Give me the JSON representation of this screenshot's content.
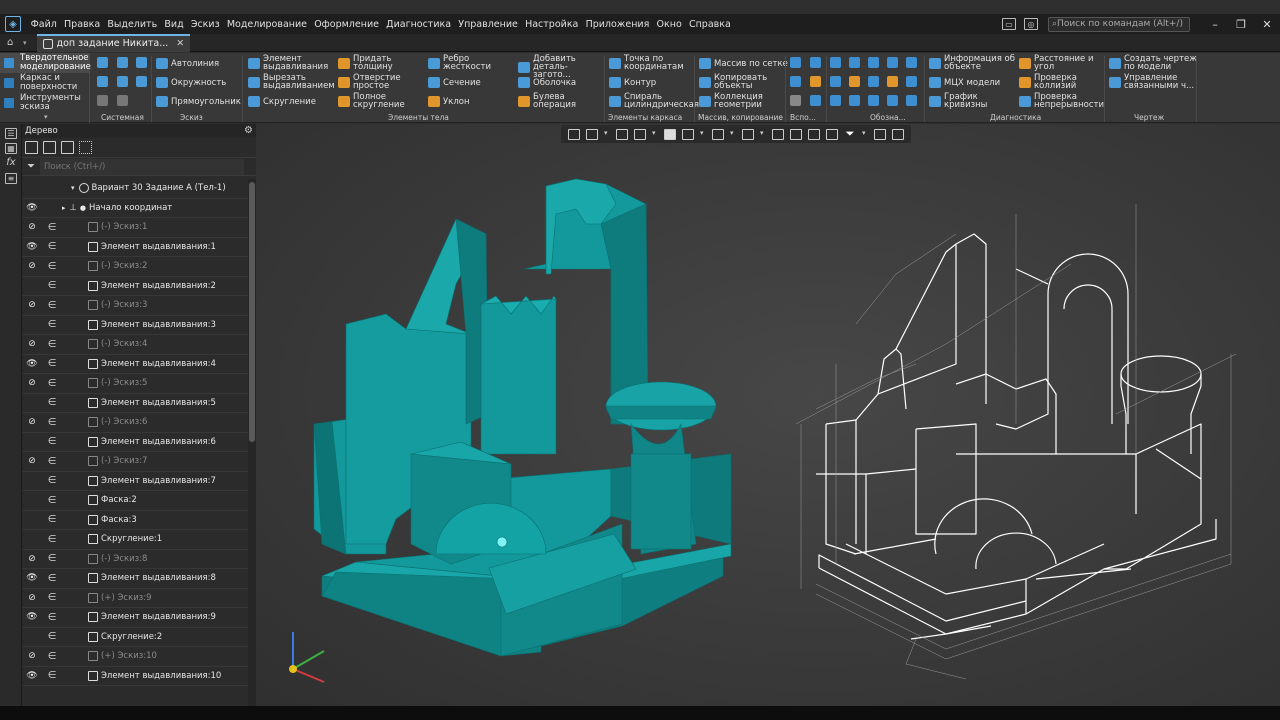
{
  "menu": [
    "Файл",
    "Правка",
    "Выделить",
    "Вид",
    "Эскиз",
    "Моделирование",
    "Оформление",
    "Диагностика",
    "Управление",
    "Настройка",
    "Приложения",
    "Окно",
    "Справка"
  ],
  "command_search": {
    "placeholder": "Поиск по командам (Alt+/)"
  },
  "document_tab": {
    "title": "доп задание Никита...",
    "close": "✕"
  },
  "ribbon": {
    "modes": [
      "Твердотельное моделирование",
      "Каркас и поверхности",
      "Инструменты эскиза"
    ],
    "groups": {
      "system": "Системная",
      "sketch": "Эскиз",
      "body": "Элементы тела",
      "frame": "Элементы каркаса",
      "array": "Массив, копирование",
      "aux": "Вспо...",
      "markup": "Обозна...",
      "diag": "Диагностика",
      "drawing": "Чертеж"
    },
    "sketch_buttons": [
      "Автолиния",
      "Окружность",
      "Прямоугольник"
    ],
    "body_buttons": [
      "Элемент выдавливания",
      "Вырезать выдавливанием",
      "Скругление",
      "Придать толщину",
      "Отверстие простое",
      "Полное скругление",
      "Ребро жесткости",
      "Сечение",
      "Уклон",
      "Добавить деталь-загото...",
      "Оболочка",
      "Булева операция"
    ],
    "frame_buttons": [
      "Точка по координатам",
      "Контур",
      "Спираль цилиндрическая"
    ],
    "array_buttons": [
      "Массив по сетке",
      "Копировать объекты",
      "Коллекция геометрии"
    ],
    "diag_buttons": [
      "Информация об объекте",
      "МЦХ модели",
      "График кривизны",
      "Расстояние и угол",
      "Проверка коллизий",
      "Проверка непрерывности"
    ],
    "drawing_buttons": [
      "Создать чертеж по модели",
      "Управление связанными ч..."
    ]
  },
  "tree": {
    "title": "Дерево",
    "search_placeholder": "Поиск (Ctrl+/)",
    "root": "Вариант 30 Задание А (Тел-1)",
    "origin": "Начало координат",
    "rows": [
      {
        "label": "(-) Эскиз:1",
        "hidden": true,
        "eye": "crossed"
      },
      {
        "label": "Элемент выдавливания:1",
        "hidden": false,
        "eye": "open"
      },
      {
        "label": "(-) Эскиз:2",
        "hidden": true,
        "eye": "crossed"
      },
      {
        "label": "Элемент выдавливания:2",
        "hidden": false,
        "eye": "none"
      },
      {
        "label": "(-) Эскиз:3",
        "hidden": true,
        "eye": "crossed"
      },
      {
        "label": "Элемент выдавливания:3",
        "hidden": false,
        "eye": "none"
      },
      {
        "label": "(-) Эскиз:4",
        "hidden": true,
        "eye": "crossed"
      },
      {
        "label": "Элемент выдавливания:4",
        "hidden": false,
        "eye": "open"
      },
      {
        "label": "(-) Эскиз:5",
        "hidden": true,
        "eye": "crossed"
      },
      {
        "label": "Элемент выдавливания:5",
        "hidden": false,
        "eye": "none"
      },
      {
        "label": "(-) Эскиз:6",
        "hidden": true,
        "eye": "crossed"
      },
      {
        "label": "Элемент выдавливания:6",
        "hidden": false,
        "eye": "none"
      },
      {
        "label": "(-) Эскиз:7",
        "hidden": true,
        "eye": "crossed"
      },
      {
        "label": "Элемент выдавливания:7",
        "hidden": false,
        "eye": "none"
      },
      {
        "label": "Фаска:2",
        "hidden": false,
        "eye": "none"
      },
      {
        "label": "Фаска:3",
        "hidden": false,
        "eye": "none"
      },
      {
        "label": "Скругление:1",
        "hidden": false,
        "eye": "none"
      },
      {
        "label": "(-) Эскиз:8",
        "hidden": true,
        "eye": "crossed"
      },
      {
        "label": "Элемент выдавливания:8",
        "hidden": false,
        "eye": "open"
      },
      {
        "label": "(+) Эскиз:9",
        "hidden": true,
        "eye": "crossed"
      },
      {
        "label": "Элемент выдавливания:9",
        "hidden": false,
        "eye": "open"
      },
      {
        "label": "Скругление:2",
        "hidden": false,
        "eye": "none"
      },
      {
        "label": "(+) Эскиз:10",
        "hidden": true,
        "eye": "crossed"
      },
      {
        "label": "Элемент выдавливания:10",
        "hidden": false,
        "eye": "open"
      }
    ]
  },
  "colors": {
    "model": "#12999b",
    "accent": "#3d8fd1",
    "wire": "#ffffff"
  }
}
